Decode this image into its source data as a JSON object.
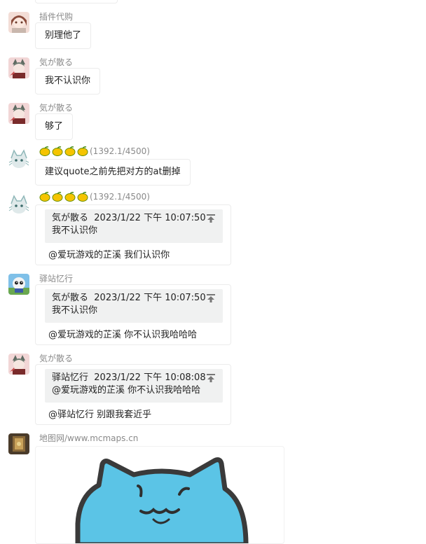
{
  "messages": [
    {
      "sender": "插件代购",
      "text": "别理他了"
    },
    {
      "sender": "気が散る",
      "text": "我不认识你"
    },
    {
      "sender": "気が散る",
      "text": "够了"
    },
    {
      "sender_badge": "(1392.1/4500)",
      "text": "建议quote之前先把对方的at删掉"
    },
    {
      "sender_badge": "(1392.1/4500)",
      "quote": {
        "name": "気が散る",
        "time": "2023/1/22 下午 10:07:50",
        "text": "我不认识你"
      },
      "reply": "@爱玩游戏的芷溪 我们认识你"
    },
    {
      "sender": "驿站忆行",
      "quote": {
        "name": "気が散る",
        "time": "2023/1/22 下午 10:07:50",
        "text": "我不认识你"
      },
      "reply": "@爱玩游戏的芷溪  你不认识我哈哈哈"
    },
    {
      "sender": "気が散る",
      "quote": {
        "name": "驿站忆行",
        "time": "2023/1/22 下午 10:08:08",
        "text": "@爱玩游戏的芷溪  你不认识我哈哈哈"
      },
      "reply": "@驿站忆行 别跟我套近乎"
    },
    {
      "sender": "地图网/www.mcmaps.cn",
      "image": "blue-cat-sticker"
    }
  ],
  "colors": {
    "sticker_blue": "#5bc4e6",
    "bubble_border": "#ececec",
    "quote_bg": "#f0f1f1",
    "sender_text": "#8a8a8a"
  }
}
